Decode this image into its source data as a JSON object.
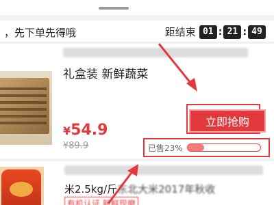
{
  "promo": {
    "text": "，先下单先得哦",
    "countdown_label": "距结束",
    "hours": "01",
    "minutes": "21",
    "seconds": "49"
  },
  "product1": {
    "title": "礼盒装 新鲜蔬菜",
    "price_symbol": "¥",
    "price": "54.9",
    "original_price": "¥89.9",
    "buy_label": "立即抢购",
    "sold_label": "已售23%",
    "sold_fraction": 0.23
  },
  "product2": {
    "title_visible": "米2.5kg/斤",
    "title_blurred": "东北大米2017年秋收",
    "tag": "有机认证 新鲜现磨"
  },
  "colors": {
    "accent": "#e4393c",
    "countdown_bg": "#222222",
    "progress_fill": "#f07b7d"
  }
}
